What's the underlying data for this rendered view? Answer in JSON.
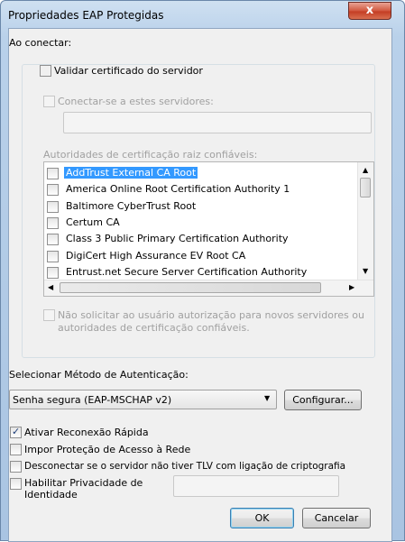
{
  "window": {
    "title": "Propriedades EAP Protegidas",
    "close_label": "x"
  },
  "connect": {
    "heading": "Ao conectar:",
    "validate_cert": {
      "label": "Validar certificado do servidor",
      "checked": false
    },
    "connect_servers": {
      "label": "Conectar-se a estes servidores:",
      "checked": false,
      "value": ""
    },
    "ca_heading": "Autoridades de certificação raiz confiáveis:",
    "ca_list": [
      {
        "label": "AddTrust External CA Root",
        "checked": false,
        "selected": true
      },
      {
        "label": "America Online Root Certification Authority 1",
        "checked": false
      },
      {
        "label": "Baltimore CyberTrust Root",
        "checked": false
      },
      {
        "label": "Certum CA",
        "checked": false
      },
      {
        "label": "Class 3 Public Primary Certification Authority",
        "checked": false
      },
      {
        "label": "DigiCert High Assurance EV Root CA",
        "checked": false
      },
      {
        "label": "Entrust.net Secure Server Certification Authority",
        "checked": false
      }
    ],
    "no_prompt": {
      "line1": "Não solicitar ao usuário autorização para novos servidores ou",
      "line2": "autoridades de certificação confiáveis.",
      "checked": false
    }
  },
  "auth": {
    "heading": "Selecionar Método de Autenticação:",
    "method": "Senha segura (EAP-MSCHAP v2)",
    "configure_label": "Configurar..."
  },
  "options": {
    "fast_reconnect": {
      "label": "Ativar Reconexão Rápida",
      "checked": true
    },
    "nap": {
      "label": "Impor Proteção de Acesso à Rede",
      "checked": false
    },
    "disconnect_tlv": {
      "label": "Desconectar se o servidor não tiver TLV com ligação de criptografia",
      "checked": false
    },
    "privacy": {
      "line1": "Habilitar Privacidade de",
      "line2": "Identidade",
      "checked": false,
      "value": ""
    }
  },
  "buttons": {
    "ok": "OK",
    "cancel": "Cancelar"
  },
  "colors": {
    "selection": "#3399ff",
    "close_button": "#c43d24",
    "title_bar": "#b9d1ea"
  }
}
